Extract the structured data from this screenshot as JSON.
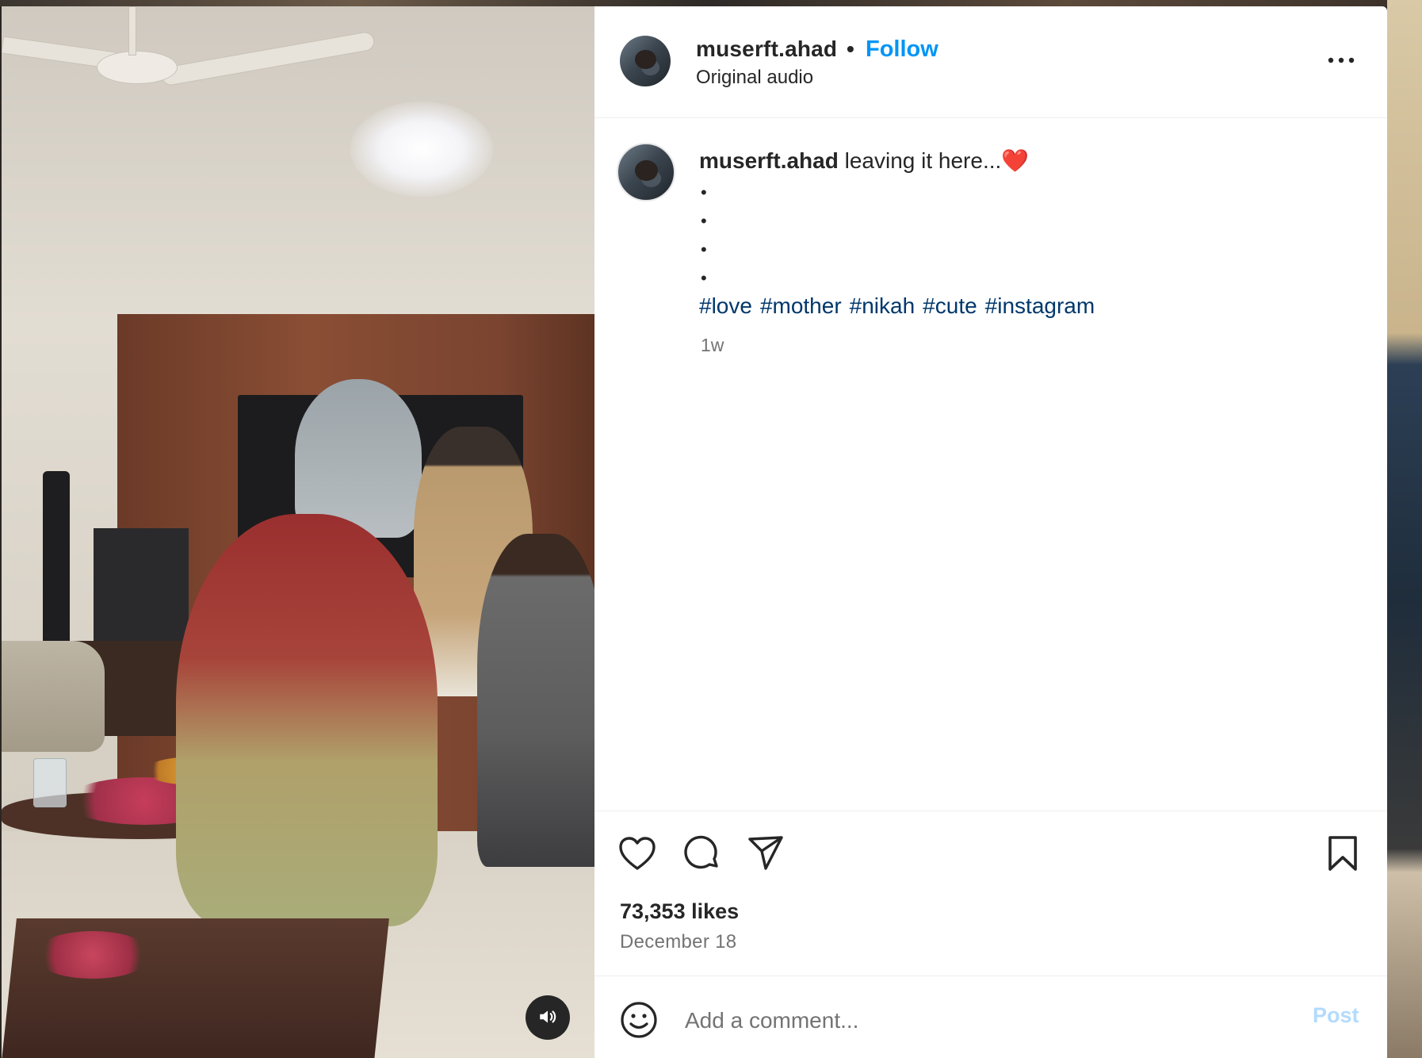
{
  "post": {
    "username": "muserft.ahad",
    "separator": "•",
    "follow_label": "Follow",
    "audio_label": "Original audio",
    "caption_text": "leaving it here...❤️",
    "caption_bullets": [
      "•",
      "•",
      "•",
      "•"
    ],
    "hashtags": [
      "#love",
      "#mother",
      "#nikah",
      "#cute",
      "#instagram"
    ],
    "time_ago": "1w",
    "likes": "73,353 likes",
    "date": "December 18"
  },
  "comment": {
    "placeholder": "Add a comment...",
    "post_label": "Post"
  },
  "icons": {
    "more": "more-options-icon",
    "like": "heart-icon",
    "comment": "comment-bubble-icon",
    "share": "paper-plane-icon",
    "save": "bookmark-icon",
    "emoji": "emoji-smiley-icon",
    "sound": "speaker-icon"
  },
  "colors": {
    "accent": "#0095f6",
    "hashtag": "#00376b",
    "muted": "#737373",
    "post_disabled": "#b3dbff"
  }
}
